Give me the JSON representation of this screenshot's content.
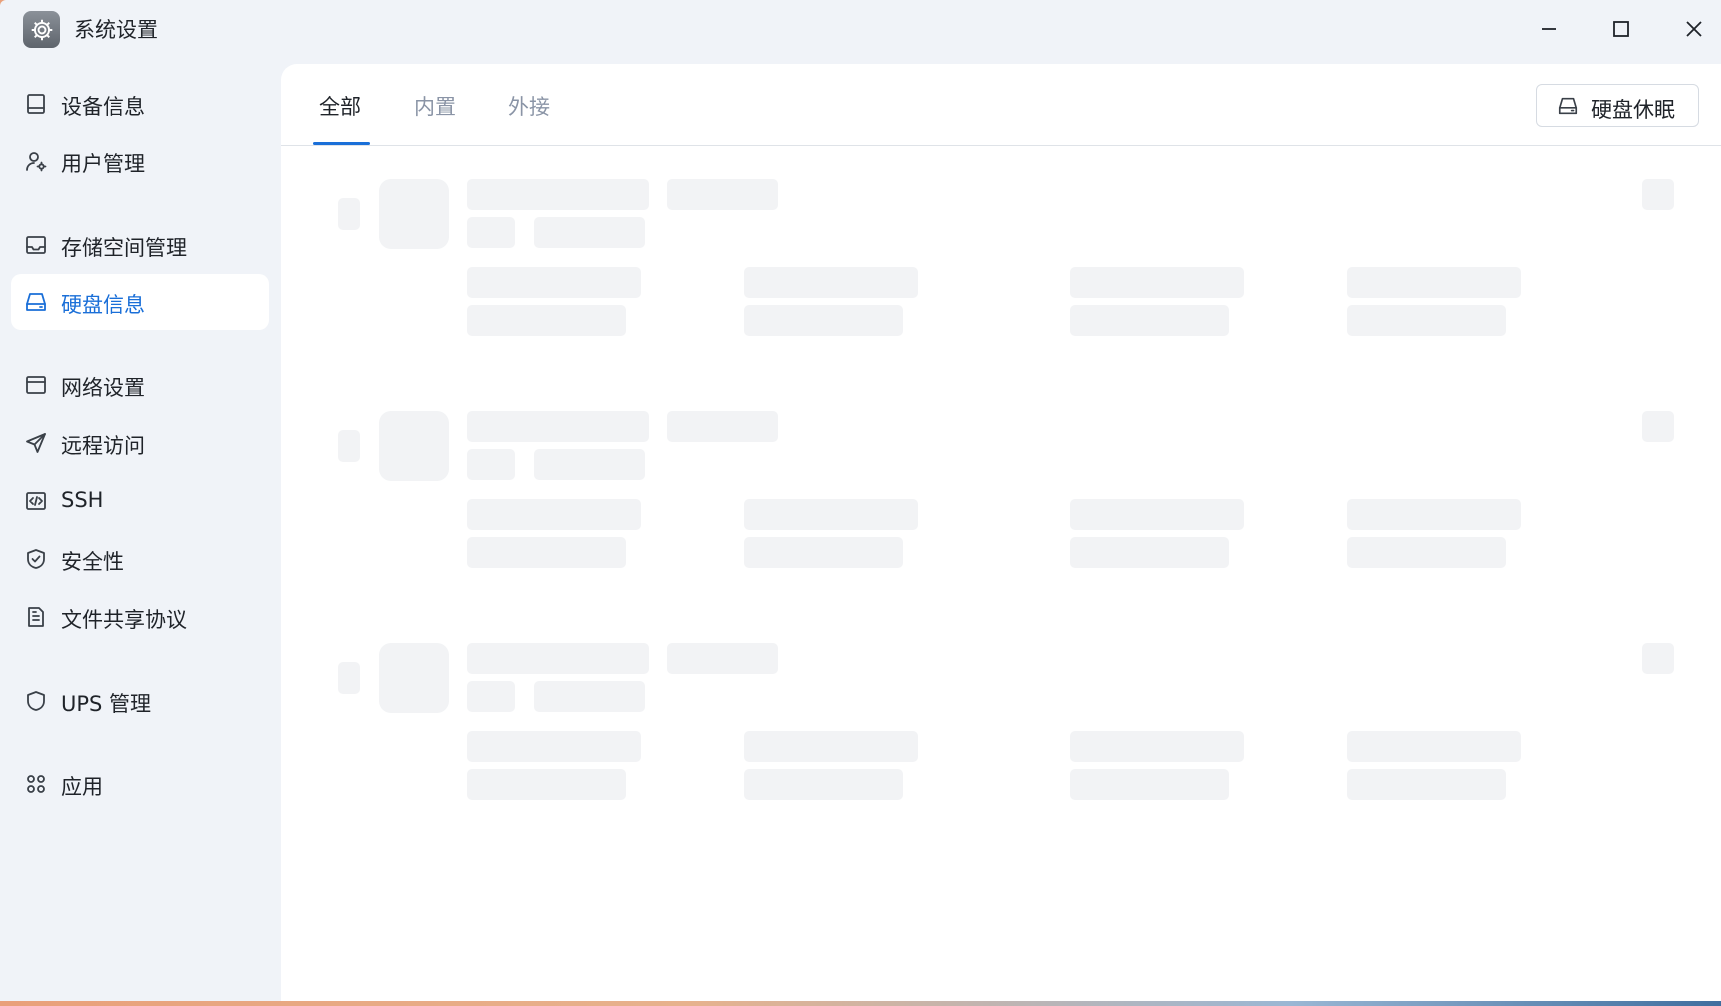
{
  "app": {
    "title": "系统设置",
    "icon": "gear-icon"
  },
  "window_controls": {
    "minimize": "minimize-icon",
    "maximize": "maximize-icon",
    "close": "close-icon"
  },
  "sidebar": {
    "active_index": 3,
    "items": [
      {
        "label": "设备信息",
        "icon": "device-icon"
      },
      {
        "label": "用户管理",
        "icon": "user-settings-icon"
      },
      {
        "label": "存储空间管理",
        "icon": "inbox-icon"
      },
      {
        "label": "硬盘信息",
        "icon": "hard-drive-icon"
      },
      {
        "label": "网络设置",
        "icon": "window-icon"
      },
      {
        "label": "远程访问",
        "icon": "send-icon"
      },
      {
        "label": "SSH",
        "icon": "code-icon"
      },
      {
        "label": "安全性",
        "icon": "shield-check-icon"
      },
      {
        "label": "文件共享协议",
        "icon": "document-icon"
      },
      {
        "label": "UPS 管理",
        "icon": "shield-icon"
      },
      {
        "label": "应用",
        "icon": "apps-icon"
      }
    ]
  },
  "main": {
    "tabs": [
      {
        "label": "全部",
        "active": true
      },
      {
        "label": "内置",
        "active": false
      },
      {
        "label": "外接",
        "active": false
      }
    ],
    "sleep_button": {
      "label": "硬盘休眠",
      "icon": "hard-drive-icon"
    },
    "loading": true
  },
  "colors": {
    "accent": "#1a6fd8",
    "skeleton": "#f2f3f5",
    "sidebar_bg": "#f0f3f8"
  }
}
